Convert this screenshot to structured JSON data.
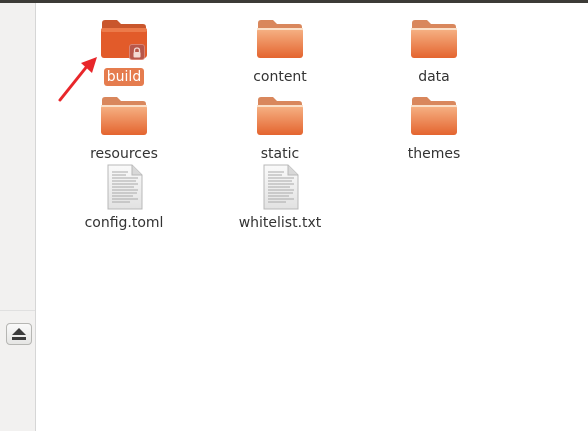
{
  "files": [
    {
      "name": "build",
      "type": "folder",
      "selected": true,
      "locked": true
    },
    {
      "name": "content",
      "type": "folder"
    },
    {
      "name": "data",
      "type": "folder"
    },
    {
      "name": "resources",
      "type": "folder"
    },
    {
      "name": "static",
      "type": "folder"
    },
    {
      "name": "themes",
      "type": "folder"
    },
    {
      "name": "config.toml",
      "type": "text-file"
    },
    {
      "name": "whitelist.txt",
      "type": "text-file"
    }
  ],
  "icons": {
    "folder": "folder-icon",
    "file": "text-file-icon",
    "lock": "lock-icon",
    "eject": "eject-icon",
    "annotation": "red-arrow-annotation"
  },
  "colors": {
    "folder_top": "#ee8a5c",
    "folder_body": "#e06a36",
    "folder_selected": "#e25b2a",
    "selection": "#e57c4e",
    "annotation_arrow": "#e8262a"
  }
}
